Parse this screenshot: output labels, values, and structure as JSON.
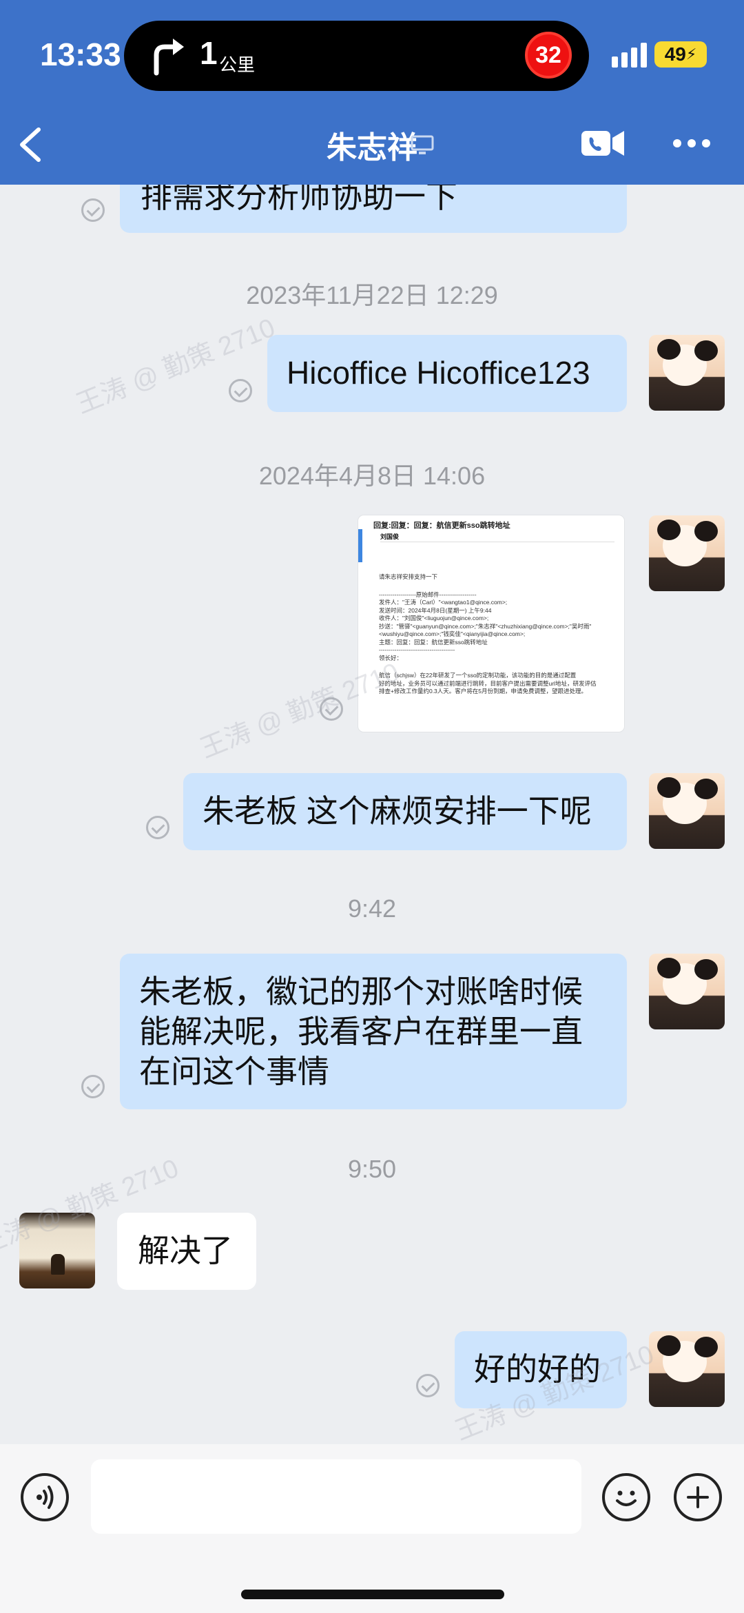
{
  "status_bar": {
    "time": "13:33",
    "navigation": {
      "distance": "1",
      "unit": "公里",
      "icon": "turn-right-arrow-icon"
    },
    "speed_limit": "32",
    "battery": "49"
  },
  "header": {
    "title": "朱志祥",
    "device_icon": "desktop-icon",
    "back_icon": "chevron-left-icon",
    "video_icon": "video-call-icon",
    "more_icon": "more-dots-icon"
  },
  "messages": [
    {
      "type": "text",
      "side": "right",
      "text": "排需求分析师协助一下"
    },
    {
      "type": "timestamp",
      "text": "2023年11月22日 12:29"
    },
    {
      "type": "text",
      "side": "right",
      "text": "Hicoffice Hicoffice123"
    },
    {
      "type": "timestamp",
      "text": "2024年4月8日 14:06"
    },
    {
      "type": "image",
      "side": "right",
      "email": {
        "subject": "回复:回复：回复：航信更新sso跳转地址",
        "sender": "刘国俊",
        "lines": [
          "请朱志祥安排支持一下",
          "-------------------原始邮件-------------------",
          "发件人：\"王涛（Carl）\"<wangtao1@qince.com>;",
          "发送时间：2024年4月8日(星期一) 上午9:44",
          "收件人：\"刘国俊\"<liuguojun@qince.com>;",
          "抄送：\"管驿\"<guanyun@qince.com>;\"朱志祥\"<zhuzhixiang@qince.com>;\"吴时雨\"",
          "<wushiyu@qince.com>;\"钱奕佳\"<qianyijia@qince.com>;",
          "主题：回复：回复：航信更新sso跳转地址",
          "---------------------------------------",
          "领长好：",
          "航信（schjsw）在22年研发了一个sso的定制功能，该功能的目的是通过配置",
          "好的地址，业务员可以通过前端进行跳转，目前客户提出需要调整url地址，研发评估",
          "排查+修改工作量约0.3人天。客户将在5月份到期，申请免费调整，望跟进处理。"
        ]
      }
    },
    {
      "type": "text",
      "side": "right",
      "text": "朱老板 这个麻烦安排一下呢"
    },
    {
      "type": "timestamp",
      "text": "9:42"
    },
    {
      "type": "text",
      "side": "right",
      "text": "朱老板，徽记的那个对账啥时候能解决呢，我看客户在群里一直在问这个事情"
    },
    {
      "type": "timestamp",
      "text": "9:50"
    },
    {
      "type": "text",
      "side": "left",
      "text": "解决了"
    },
    {
      "type": "text",
      "side": "right",
      "text": "好的好的"
    }
  ],
  "watermark": "王涛 @ 勤策 2710",
  "input_bar": {
    "voice_icon": "voice-icon",
    "emoji_icon": "emoji-icon",
    "add_icon": "plus-icon",
    "placeholder": ""
  }
}
